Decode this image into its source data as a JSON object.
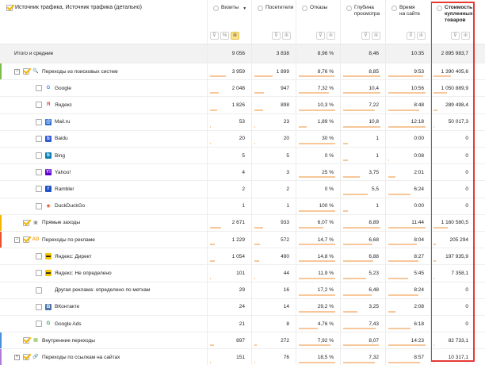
{
  "header": {
    "dimension_label": "Источник трафика, Источник трафика (детально)",
    "metrics": [
      {
        "label": "Визиты",
        "sorted": true,
        "sort_glyph": "▼"
      },
      {
        "label": "Посетители",
        "sorted": false
      },
      {
        "label": "Отказы",
        "sorted": false
      },
      {
        "label": "Глубина\nпросмотра",
        "sorted": false
      },
      {
        "label": "Время\nна сайте",
        "sorted": false
      },
      {
        "label": "Стоимость\nкупленных\nтоваров",
        "sorted": false,
        "bold": true
      }
    ],
    "tool_glyphs": {
      "filter": "⊽",
      "percent": "%",
      "bars": "ılı"
    }
  },
  "total": {
    "label": "Итого и средние",
    "values": [
      "9 056",
      "3 838",
      "8,96 %",
      "8,46",
      "10:35",
      "2 895 983,7"
    ]
  },
  "rows": [
    {
      "level": 0,
      "expander": "−",
      "checked": true,
      "icon": "search",
      "icon_glyph": "🔍",
      "icon_color": "#e8502f",
      "accent": "#7bbf4a",
      "label": "Переходы из поисковых систем",
      "values": [
        "3 959",
        "1 899",
        "8,76 %",
        "8,85",
        "9:53",
        "1 390 405,6"
      ],
      "bars": [
        0.44,
        0.49,
        0.98,
        1.0,
        0.93,
        0.48
      ]
    },
    {
      "level": 1,
      "checked": false,
      "icon": "google",
      "icon_glyph": "G",
      "icon_color": "#4285f4",
      "label": "Google",
      "values": [
        "2 048",
        "947",
        "7,32 %",
        "10,4",
        "10:56",
        "1 050 889,9"
      ],
      "bars": [
        0.23,
        0.25,
        0.82,
        1.0,
        1.0,
        0.36
      ]
    },
    {
      "level": 1,
      "checked": false,
      "icon": "yandex",
      "icon_glyph": "Я",
      "icon_color": "#e53935",
      "label": "Яндекс",
      "values": [
        "1 826",
        "898",
        "10,3 %",
        "7,22",
        "8:48",
        "289 498,4"
      ],
      "bars": [
        0.2,
        0.23,
        1.0,
        0.85,
        0.83,
        0.1
      ]
    },
    {
      "level": 1,
      "checked": false,
      "icon": "mailru",
      "icon_glyph": "@",
      "icon_color": "#2b6fd6",
      "label": "Mail.ru",
      "values": [
        "53",
        "23",
        "1,89 %",
        "10,8",
        "12:18",
        "50 017,3"
      ],
      "bars": [
        0.02,
        0.02,
        0.21,
        1.0,
        1.0,
        0.03
      ]
    },
    {
      "level": 1,
      "checked": false,
      "icon": "baidu",
      "icon_glyph": "b",
      "icon_color": "#3059d6",
      "label": "Baidu",
      "values": [
        "20",
        "20",
        "30 %",
        "1",
        "0:00",
        "0"
      ],
      "bars": [
        0.01,
        0.01,
        1.0,
        0.12,
        0,
        0
      ]
    },
    {
      "level": 1,
      "checked": false,
      "icon": "bing",
      "icon_glyph": "b",
      "icon_color": "#0a7fb8",
      "label": "Bing",
      "values": [
        "5",
        "5",
        "0 %",
        "1",
        "0:08",
        "0"
      ],
      "bars": [
        0,
        0,
        0,
        0.12,
        0.02,
        0
      ]
    },
    {
      "level": 1,
      "checked": false,
      "icon": "yahoo",
      "icon_glyph": "Y!",
      "icon_color": "#6001d2",
      "label": "Yahoo!",
      "values": [
        "4",
        "3",
        "25 %",
        "3,75",
        "2:01",
        "0"
      ],
      "bars": [
        0,
        0,
        1.0,
        0.44,
        0.19,
        0
      ]
    },
    {
      "level": 1,
      "checked": false,
      "icon": "rambler",
      "icon_glyph": "r",
      "icon_color": "#1e50c8",
      "label": "Rambler",
      "values": [
        "2",
        "2",
        "0 %",
        "5,5",
        "6:24",
        "0"
      ],
      "bars": [
        0,
        0,
        0,
        0.65,
        0.6,
        0
      ]
    },
    {
      "level": 1,
      "checked": false,
      "icon": "duckduckgo",
      "icon_glyph": "◉",
      "icon_color": "#de5833",
      "label": "DuckDuckGo",
      "values": [
        "1",
        "1",
        "100 %",
        "1",
        "0:00",
        "0"
      ],
      "bars": [
        0,
        0,
        1.0,
        0.12,
        0,
        0
      ]
    },
    {
      "level": 0,
      "checked": true,
      "icon": "direct",
      "icon_glyph": "▣",
      "icon_color": "#8a8a8a",
      "accent": "#f5b400",
      "label": "Прямые заходы",
      "values": [
        "2 671",
        "933",
        "6,07 %",
        "8,89",
        "11:44",
        "1 160 580,5"
      ],
      "bars": [
        0.3,
        0.24,
        0.68,
        1.0,
        1.0,
        0.4
      ]
    },
    {
      "level": 0,
      "expander": "−",
      "checked": true,
      "icon": "ads",
      "icon_glyph": "AD",
      "icon_color": "#f5a623",
      "accent": "#e8502f",
      "label": "Переходы по рекламе",
      "values": [
        "1 229",
        "572",
        "14,7 %",
        "6,68",
        "8:04",
        "205 294"
      ],
      "bars": [
        0.14,
        0.15,
        1.0,
        0.79,
        0.76,
        0.07
      ]
    },
    {
      "level": 1,
      "checked": false,
      "icon": "direct-ads",
      "icon_glyph": "▬",
      "icon_color": "#f5c400",
      "label": "Яндекс: Директ",
      "values": [
        "1 054",
        "490",
        "14,8 %",
        "6,88",
        "8:27",
        "197 935,9"
      ],
      "bars": [
        0.12,
        0.13,
        1.0,
        0.81,
        0.8,
        0.07
      ]
    },
    {
      "level": 1,
      "checked": false,
      "icon": "direct-ads",
      "icon_glyph": "▬",
      "icon_color": "#f5c400",
      "label": "Яндекс: Не определено",
      "values": [
        "101",
        "44",
        "11,9 %",
        "5,23",
        "5:45",
        "7 358,1"
      ],
      "bars": [
        0.01,
        0.01,
        1.0,
        0.62,
        0.54,
        0.01
      ]
    },
    {
      "level": 1,
      "checked": false,
      "icon": "none",
      "icon_glyph": "",
      "icon_color": "#ffffff",
      "label": "Другая реклама: определено по меткам",
      "values": [
        "29",
        "16",
        "17,2 %",
        "6,48",
        "8:24",
        "0"
      ],
      "bars": [
        0,
        0,
        1.0,
        0.77,
        0.8,
        0
      ]
    },
    {
      "level": 1,
      "checked": false,
      "icon": "vk",
      "icon_glyph": "В",
      "icon_color": "#4a76a8",
      "label": "ВКонтакте",
      "values": [
        "24",
        "14",
        "29,2 %",
        "3,25",
        "2:08",
        "0"
      ],
      "bars": [
        0,
        0,
        1.0,
        0.38,
        0.2,
        0
      ]
    },
    {
      "level": 1,
      "checked": false,
      "icon": "google-ads",
      "icon_glyph": "G",
      "icon_color": "#34a853",
      "label": "Google Ads",
      "values": [
        "21",
        "8",
        "4,76 %",
        "7,43",
        "6:18",
        "0"
      ],
      "bars": [
        0,
        0,
        0.53,
        0.88,
        0.6,
        0
      ]
    },
    {
      "level": 0,
      "checked": true,
      "icon": "internal",
      "icon_glyph": "▦",
      "icon_color": "#7bbf4a",
      "accent": "#4a90d9",
      "label": "Внутренние переходы",
      "values": [
        "897",
        "272",
        "7,92 %",
        "8,07",
        "14:23",
        "82 733,1"
      ],
      "bars": [
        0.1,
        0.07,
        0.88,
        0.95,
        1.0,
        0.03
      ]
    },
    {
      "level": 0,
      "expander": "+",
      "checked": true,
      "icon": "link",
      "icon_glyph": "🔗",
      "icon_color": "#4a90d9",
      "accent": "#b07cd8",
      "label": "Переходы по ссылкам на сайтах",
      "values": [
        "151",
        "76",
        "18,5 %",
        "7,32",
        "8:57",
        "10 317,1"
      ],
      "bars": [
        0.02,
        0.02,
        1.0,
        0.86,
        0.85,
        0.01
      ]
    }
  ]
}
